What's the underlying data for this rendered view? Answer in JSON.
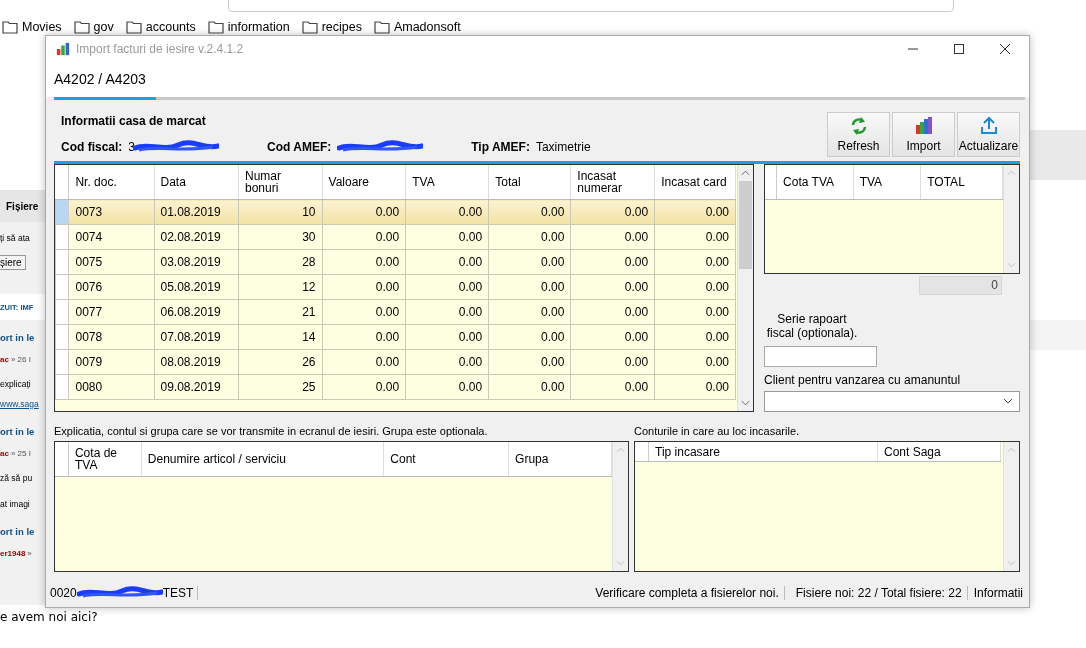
{
  "browser": {
    "bookmarks": [
      "Movies",
      "gov",
      "accounts",
      "information",
      "recipes",
      "Amadonsoft"
    ],
    "page_fragments": [
      {
        "kind": "tab",
        "text": "Fișiere"
      },
      {
        "kind": "text",
        "text": "ți să ata"
      },
      {
        "kind": "button",
        "text": "șiere"
      },
      {
        "kind": "notice",
        "text": "ZUIT: IMF"
      },
      {
        "kind": "heading",
        "text": "ort in le"
      },
      {
        "kind": "meta",
        "author": "ac",
        "text": "» 26 I"
      },
      {
        "kind": "text",
        "text": "explicați"
      },
      {
        "kind": "link",
        "text": "www.saga"
      },
      {
        "kind": "heading",
        "text": "ort in le"
      },
      {
        "kind": "meta",
        "author": "ac",
        "text": "» 25 I"
      },
      {
        "kind": "text",
        "text": "ză să pu"
      },
      {
        "kind": "text",
        "text": "at imagi"
      },
      {
        "kind": "heading",
        "text": "ort in le"
      },
      {
        "kind": "meta",
        "author": "er1948",
        "text": "»"
      }
    ],
    "page_footer": "e avem noi aici?"
  },
  "window": {
    "title": "Import facturi de iesire v.2.4.1.2"
  },
  "tabs": [
    {
      "label": "A4202 / A4203",
      "selected": true
    }
  ],
  "info": {
    "heading": "Informatii casa de marcat",
    "fields": [
      {
        "label": "Cod fiscal:",
        "value": "3",
        "redacted": true
      },
      {
        "label": "Cod AMEF:",
        "redacted": true
      },
      {
        "label": "Tip AMEF:",
        "value": "Taximetrie",
        "redacted": false
      }
    ]
  },
  "toolbar": [
    {
      "label": "Refresh",
      "kind": "refresh"
    },
    {
      "label": "Import",
      "kind": "import"
    },
    {
      "label": "Actualizare",
      "kind": "upload"
    }
  ],
  "documents": {
    "columns": [
      "Nr. doc.",
      "Data",
      "Numar bonuri",
      "Valoare",
      "TVA",
      "Total",
      "Incasat numerar",
      "Incasat card"
    ],
    "rows": [
      {
        "selected": true,
        "cells": [
          "0073",
          "01.08.2019",
          "10",
          "0.00",
          "0.00",
          "0.00",
          "0.00",
          "0.00"
        ]
      },
      {
        "selected": false,
        "cells": [
          "0074",
          "02.08.2019",
          "30",
          "0.00",
          "0.00",
          "0.00",
          "0.00",
          "0.00"
        ]
      },
      {
        "selected": false,
        "cells": [
          "0075",
          "03.08.2019",
          "28",
          "0.00",
          "0.00",
          "0.00",
          "0.00",
          "0.00"
        ]
      },
      {
        "selected": false,
        "cells": [
          "0076",
          "05.08.2019",
          "12",
          "0.00",
          "0.00",
          "0.00",
          "0.00",
          "0.00"
        ]
      },
      {
        "selected": false,
        "cells": [
          "0077",
          "06.08.2019",
          "21",
          "0.00",
          "0.00",
          "0.00",
          "0.00",
          "0.00"
        ]
      },
      {
        "selected": false,
        "cells": [
          "0078",
          "07.08.2019",
          "14",
          "0.00",
          "0.00",
          "0.00",
          "0.00",
          "0.00"
        ]
      },
      {
        "selected": false,
        "cells": [
          "0079",
          "08.08.2019",
          "26",
          "0.00",
          "0.00",
          "0.00",
          "0.00",
          "0.00"
        ]
      },
      {
        "selected": false,
        "cells": [
          "0080",
          "09.08.2019",
          "25",
          "0.00",
          "0.00",
          "0.00",
          "0.00",
          "0.00"
        ]
      }
    ]
  },
  "vat_grid": {
    "columns": [
      "Cota TVA",
      "TVA",
      "TOTAL"
    ],
    "total": "0"
  },
  "serie_label": "Serie rapoart fiscal (optionala).",
  "client_label": "Client pentru vanzarea cu amanuntul",
  "lines_note": "Explicatia, contul si grupa care se vor transmite in ecranul de iesiri. Grupa este optionala.",
  "lines_grid": {
    "columns": [
      "Cota de TVA",
      "Denumire articol / serviciu",
      "Cont",
      "Grupa"
    ]
  },
  "accounts_note": "Conturile in care au loc incasarile.",
  "accounts_grid": {
    "columns": [
      "Tip incasare",
      "Cont Saga"
    ]
  },
  "status_bar": {
    "left": {
      "prefix": "0020",
      "redacted": true,
      "suffix": "TEST"
    },
    "right": [
      "Verificare completa a fisierelor noi.",
      "Fisiere noi: 22 / Total fisiere: 22",
      "Informatii"
    ]
  }
}
